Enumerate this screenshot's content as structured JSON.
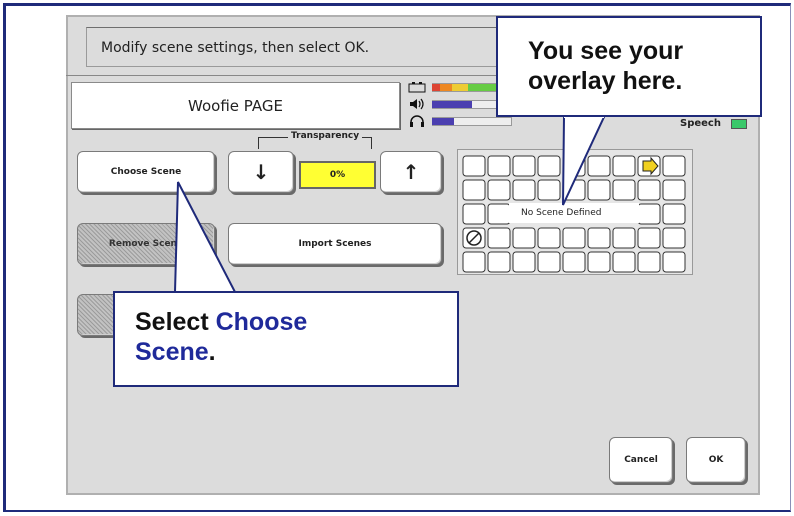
{
  "instruction": "Modify scene settings, then select OK.",
  "page_name": "Woofie PAGE",
  "meters": {
    "battery_icon": "battery-icon",
    "speaker_icon": "speaker-icon",
    "headphone_icon": "headphone-icon",
    "speech_label": "Speech",
    "speech_color": "#3ac86a"
  },
  "buttons": {
    "choose_scene": "Choose Scene",
    "remove_scene": "Remove Scene",
    "import_scenes": "Import Scenes",
    "down_arrow": "↓",
    "up_arrow": "↑",
    "cancel": "Cancel",
    "ok": "OK"
  },
  "transparency": {
    "label": "Transparency",
    "value": "0%"
  },
  "grid": {
    "placeholder": "No Scene Defined"
  },
  "callouts": {
    "overlay_line1": "You see your",
    "overlay_line2": "overlay here.",
    "select_prefix": "Select ",
    "select_choose": "Choose",
    "select_scene": "Scene",
    "select_period": "."
  },
  "colors": {
    "frame": "#1f2a7a",
    "accent_text": "#1f2a9a",
    "transparency_bg": "#ffff33"
  }
}
